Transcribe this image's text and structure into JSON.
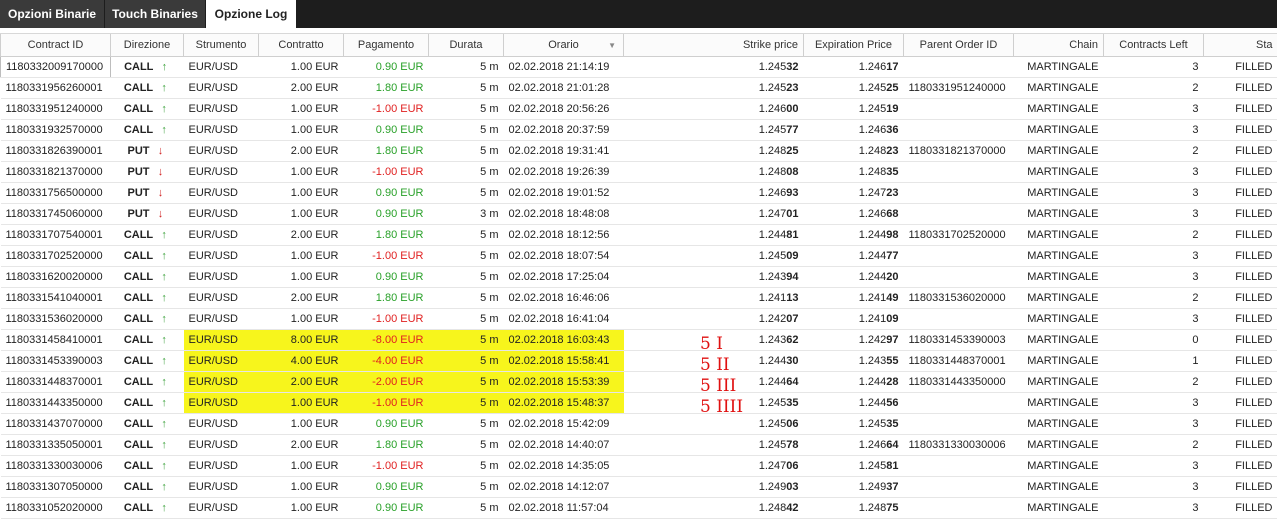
{
  "tabs": [
    "Opzioni Binarie",
    "Touch Binaries",
    "Opzione Log"
  ],
  "columns": [
    "Contract ID",
    "Direzione",
    "Strumento",
    "Contratto",
    "Pagamento",
    "Durata",
    "Orario",
    "Strike price",
    "Expiration Price",
    "Parent Order ID",
    "Chain",
    "Contracts Left",
    "Sta"
  ],
  "rows": [
    {
      "id": "1180332009170000",
      "dir": "CALL",
      "inst": "EUR/USD",
      "contr": "1.00 EUR",
      "pay": "0.90 EUR",
      "dur": "5 m",
      "time": "02.02.2018 21:14:19",
      "sp_a": "1.245",
      "sp_b": "32",
      "ep_a": "1.246",
      "ep_b": "17",
      "parent": "",
      "chain": "MARTINGALE",
      "left": "3",
      "status": "FILLED"
    },
    {
      "id": "1180331956260001",
      "dir": "CALL",
      "inst": "EUR/USD",
      "contr": "2.00 EUR",
      "pay": "1.80 EUR",
      "dur": "5 m",
      "time": "02.02.2018 21:01:28",
      "sp_a": "1.245",
      "sp_b": "23",
      "ep_a": "1.245",
      "ep_b": "25",
      "parent": "1180331951240000",
      "chain": "MARTINGALE",
      "left": "2",
      "status": "FILLED"
    },
    {
      "id": "1180331951240000",
      "dir": "CALL",
      "inst": "EUR/USD",
      "contr": "1.00 EUR",
      "pay": "-1.00 EUR",
      "dur": "5 m",
      "time": "02.02.2018 20:56:26",
      "sp_a": "1.246",
      "sp_b": "00",
      "ep_a": "1.245",
      "ep_b": "19",
      "parent": "",
      "chain": "MARTINGALE",
      "left": "3",
      "status": "FILLED"
    },
    {
      "id": "1180331932570000",
      "dir": "CALL",
      "inst": "EUR/USD",
      "contr": "1.00 EUR",
      "pay": "0.90 EUR",
      "dur": "5 m",
      "time": "02.02.2018 20:37:59",
      "sp_a": "1.245",
      "sp_b": "77",
      "ep_a": "1.246",
      "ep_b": "36",
      "parent": "",
      "chain": "MARTINGALE",
      "left": "3",
      "status": "FILLED"
    },
    {
      "id": "1180331826390001",
      "dir": "PUT",
      "inst": "EUR/USD",
      "contr": "2.00 EUR",
      "pay": "1.80 EUR",
      "dur": "5 m",
      "time": "02.02.2018 19:31:41",
      "sp_a": "1.248",
      "sp_b": "25",
      "ep_a": "1.248",
      "ep_b": "23",
      "parent": "1180331821370000",
      "chain": "MARTINGALE",
      "left": "2",
      "status": "FILLED"
    },
    {
      "id": "1180331821370000",
      "dir": "PUT",
      "inst": "EUR/USD",
      "contr": "1.00 EUR",
      "pay": "-1.00 EUR",
      "dur": "5 m",
      "time": "02.02.2018 19:26:39",
      "sp_a": "1.248",
      "sp_b": "08",
      "ep_a": "1.248",
      "ep_b": "35",
      "parent": "",
      "chain": "MARTINGALE",
      "left": "3",
      "status": "FILLED"
    },
    {
      "id": "1180331756500000",
      "dir": "PUT",
      "inst": "EUR/USD",
      "contr": "1.00 EUR",
      "pay": "0.90 EUR",
      "dur": "5 m",
      "time": "02.02.2018 19:01:52",
      "sp_a": "1.246",
      "sp_b": "93",
      "ep_a": "1.247",
      "ep_b": "23",
      "parent": "",
      "chain": "MARTINGALE",
      "left": "3",
      "status": "FILLED"
    },
    {
      "id": "1180331745060000",
      "dir": "PUT",
      "inst": "EUR/USD",
      "contr": "1.00 EUR",
      "pay": "0.90 EUR",
      "dur": "3 m",
      "time": "02.02.2018 18:48:08",
      "sp_a": "1.247",
      "sp_b": "01",
      "ep_a": "1.246",
      "ep_b": "68",
      "parent": "",
      "chain": "MARTINGALE",
      "left": "3",
      "status": "FILLED"
    },
    {
      "id": "1180331707540001",
      "dir": "CALL",
      "inst": "EUR/USD",
      "contr": "2.00 EUR",
      "pay": "1.80 EUR",
      "dur": "5 m",
      "time": "02.02.2018 18:12:56",
      "sp_a": "1.244",
      "sp_b": "81",
      "ep_a": "1.244",
      "ep_b": "98",
      "parent": "1180331702520000",
      "chain": "MARTINGALE",
      "left": "2",
      "status": "FILLED"
    },
    {
      "id": "1180331702520000",
      "dir": "CALL",
      "inst": "EUR/USD",
      "contr": "1.00 EUR",
      "pay": "-1.00 EUR",
      "dur": "5 m",
      "time": "02.02.2018 18:07:54",
      "sp_a": "1.245",
      "sp_b": "09",
      "ep_a": "1.244",
      "ep_b": "77",
      "parent": "",
      "chain": "MARTINGALE",
      "left": "3",
      "status": "FILLED"
    },
    {
      "id": "1180331620020000",
      "dir": "CALL",
      "inst": "EUR/USD",
      "contr": "1.00 EUR",
      "pay": "0.90 EUR",
      "dur": "5 m",
      "time": "02.02.2018 17:25:04",
      "sp_a": "1.243",
      "sp_b": "94",
      "ep_a": "1.244",
      "ep_b": "20",
      "parent": "",
      "chain": "MARTINGALE",
      "left": "3",
      "status": "FILLED"
    },
    {
      "id": "1180331541040001",
      "dir": "CALL",
      "inst": "EUR/USD",
      "contr": "2.00 EUR",
      "pay": "1.80 EUR",
      "dur": "5 m",
      "time": "02.02.2018 16:46:06",
      "sp_a": "1.241",
      "sp_b": "13",
      "ep_a": "1.241",
      "ep_b": "49",
      "parent": "1180331536020000",
      "chain": "MARTINGALE",
      "left": "2",
      "status": "FILLED"
    },
    {
      "id": "1180331536020000",
      "dir": "CALL",
      "inst": "EUR/USD",
      "contr": "1.00 EUR",
      "pay": "-1.00 EUR",
      "dur": "5 m",
      "time": "02.02.2018 16:41:04",
      "sp_a": "1.242",
      "sp_b": "07",
      "ep_a": "1.241",
      "ep_b": "09",
      "parent": "",
      "chain": "MARTINGALE",
      "left": "3",
      "status": "FILLED"
    },
    {
      "id": "1180331458410001",
      "dir": "CALL",
      "inst": "EUR/USD",
      "contr": "8.00 EUR",
      "pay": "-8.00 EUR",
      "dur": "5 m",
      "time": "02.02.2018 16:03:43",
      "sp_a": "1.243",
      "sp_b": "62",
      "ep_a": "1.242",
      "ep_b": "97",
      "parent": "1180331453390003",
      "chain": "MARTINGALE",
      "left": "0",
      "status": "FILLED",
      "hl": true
    },
    {
      "id": "1180331453390003",
      "dir": "CALL",
      "inst": "EUR/USD",
      "contr": "4.00 EUR",
      "pay": "-4.00 EUR",
      "dur": "5 m",
      "time": "02.02.2018 15:58:41",
      "sp_a": "1.244",
      "sp_b": "30",
      "ep_a": "1.243",
      "ep_b": "55",
      "parent": "1180331448370001",
      "chain": "MARTINGALE",
      "left": "1",
      "status": "FILLED",
      "hl": true
    },
    {
      "id": "1180331448370001",
      "dir": "CALL",
      "inst": "EUR/USD",
      "contr": "2.00 EUR",
      "pay": "-2.00 EUR",
      "dur": "5 m",
      "time": "02.02.2018 15:53:39",
      "sp_a": "1.244",
      "sp_b": "64",
      "ep_a": "1.244",
      "ep_b": "28",
      "parent": "1180331443350000",
      "chain": "MARTINGALE",
      "left": "2",
      "status": "FILLED",
      "hl": true
    },
    {
      "id": "1180331443350000",
      "dir": "CALL",
      "inst": "EUR/USD",
      "contr": "1.00 EUR",
      "pay": "-1.00 EUR",
      "dur": "5 m",
      "time": "02.02.2018 15:48:37",
      "sp_a": "1.245",
      "sp_b": "35",
      "ep_a": "1.244",
      "ep_b": "56",
      "parent": "",
      "chain": "MARTINGALE",
      "left": "3",
      "status": "FILLED",
      "hl": true
    },
    {
      "id": "1180331437070000",
      "dir": "CALL",
      "inst": "EUR/USD",
      "contr": "1.00 EUR",
      "pay": "0.90 EUR",
      "dur": "5 m",
      "time": "02.02.2018 15:42:09",
      "sp_a": "1.245",
      "sp_b": "06",
      "ep_a": "1.245",
      "ep_b": "35",
      "parent": "",
      "chain": "MARTINGALE",
      "left": "3",
      "status": "FILLED"
    },
    {
      "id": "1180331335050001",
      "dir": "CALL",
      "inst": "EUR/USD",
      "contr": "2.00 EUR",
      "pay": "1.80 EUR",
      "dur": "5 m",
      "time": "02.02.2018 14:40:07",
      "sp_a": "1.245",
      "sp_b": "78",
      "ep_a": "1.246",
      "ep_b": "64",
      "parent": "1180331330030006",
      "chain": "MARTINGALE",
      "left": "2",
      "status": "FILLED"
    },
    {
      "id": "1180331330030006",
      "dir": "CALL",
      "inst": "EUR/USD",
      "contr": "1.00 EUR",
      "pay": "-1.00 EUR",
      "dur": "5 m",
      "time": "02.02.2018 14:35:05",
      "sp_a": "1.247",
      "sp_b": "06",
      "ep_a": "1.245",
      "ep_b": "81",
      "parent": "",
      "chain": "MARTINGALE",
      "left": "3",
      "status": "FILLED"
    },
    {
      "id": "1180331307050000",
      "dir": "CALL",
      "inst": "EUR/USD",
      "contr": "1.00 EUR",
      "pay": "0.90 EUR",
      "dur": "5 m",
      "time": "02.02.2018 14:12:07",
      "sp_a": "1.249",
      "sp_b": "03",
      "ep_a": "1.249",
      "ep_b": "37",
      "parent": "",
      "chain": "MARTINGALE",
      "left": "3",
      "status": "FILLED"
    },
    {
      "id": "1180331052020000",
      "dir": "CALL",
      "inst": "EUR/USD",
      "contr": "1.00 EUR",
      "pay": "0.90 EUR",
      "dur": "5 m",
      "time": "02.02.2018 11:57:04",
      "sp_a": "1.248",
      "sp_b": "42",
      "ep_a": "1.248",
      "ep_b": "75",
      "parent": "",
      "chain": "MARTINGALE",
      "left": "3",
      "status": "FILLED"
    }
  ],
  "annotations": [
    "5 I",
    "5 II",
    "5 III",
    "5 IIII"
  ],
  "colors": {
    "gain": "#28a028",
    "loss": "#e02020",
    "highlight": "#f7f51c",
    "arrow_up": "#3ea33e",
    "arrow_down": "#d02020"
  }
}
